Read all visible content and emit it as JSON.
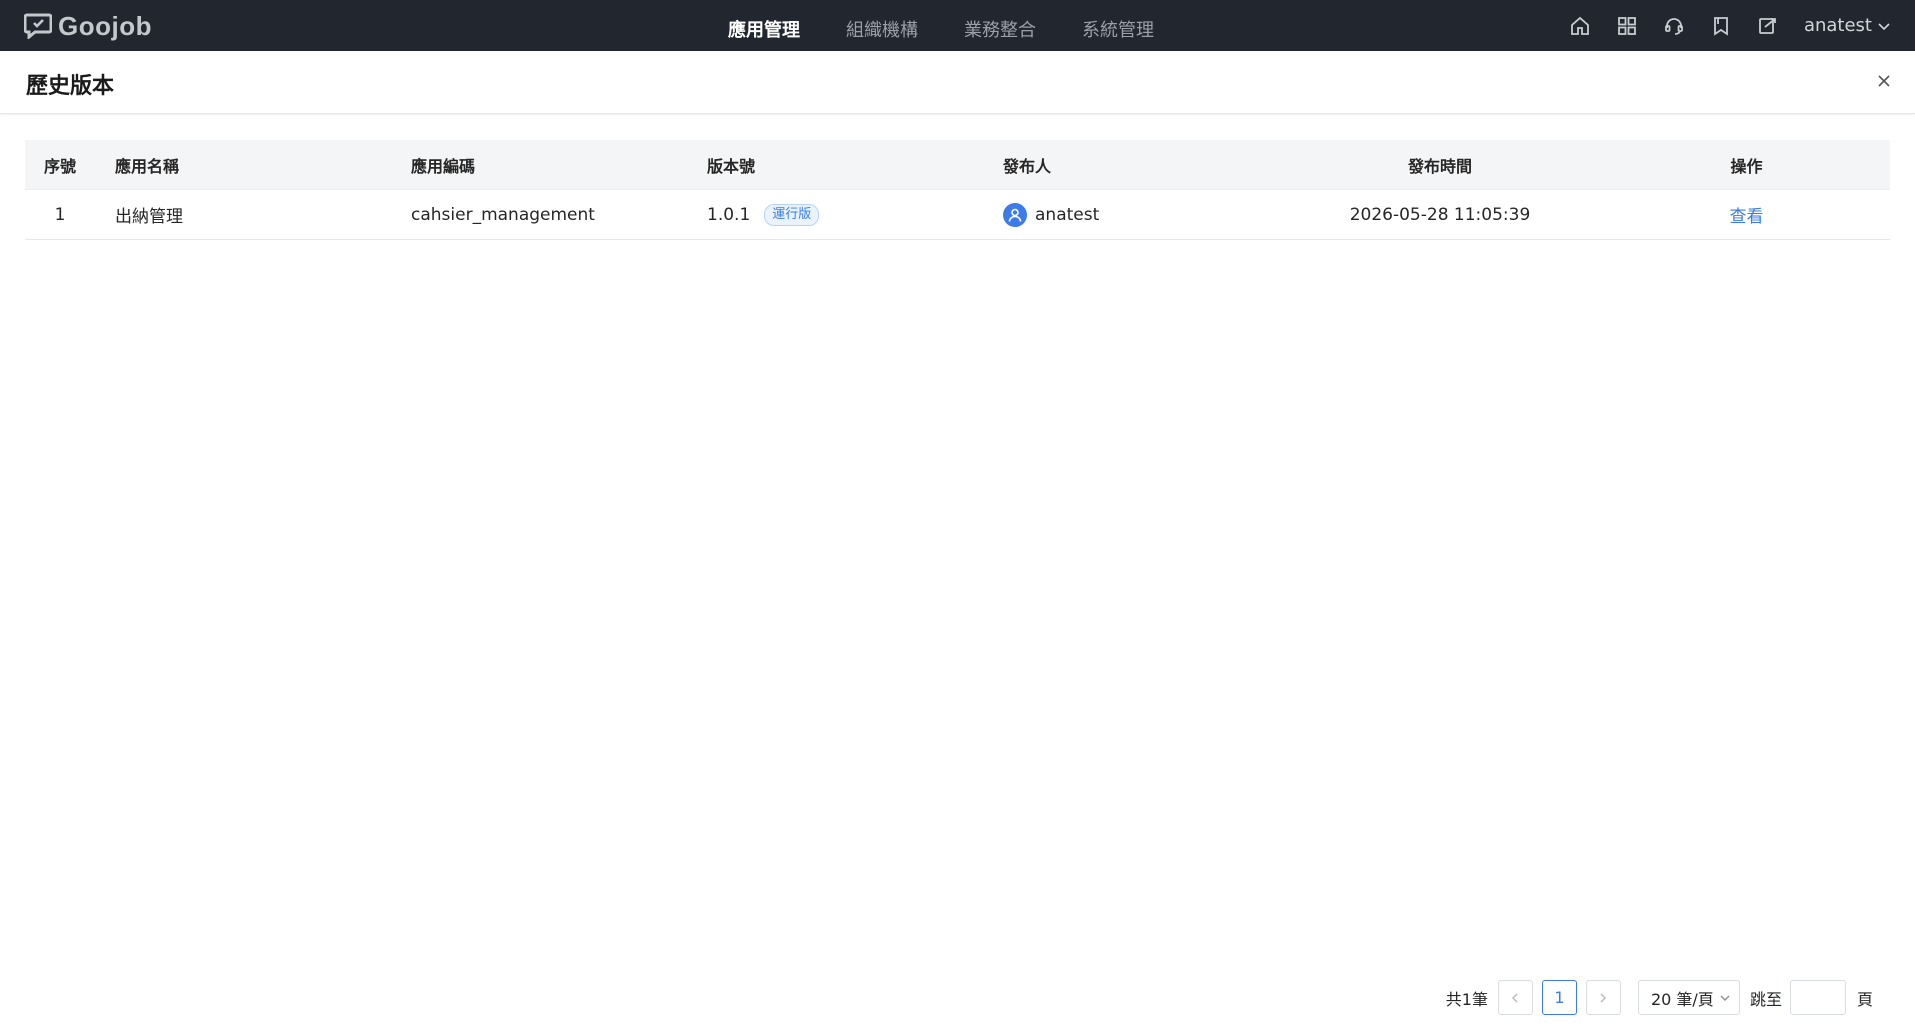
{
  "brand": {
    "name": "Goojob"
  },
  "nav": {
    "items": [
      {
        "label": "應用管理",
        "active": true
      },
      {
        "label": "組織機構",
        "active": false
      },
      {
        "label": "業務整合",
        "active": false
      },
      {
        "label": "系統管理",
        "active": false
      }
    ]
  },
  "toolbar": {
    "icons": [
      "home-icon",
      "apps-grid-icon",
      "support-headset-icon",
      "bookmark-icon",
      "edit-export-icon"
    ],
    "username": "anatest"
  },
  "dialog": {
    "title": "歷史版本"
  },
  "table": {
    "headers": {
      "index": "序號",
      "app_name": "應用名稱",
      "app_code": "應用編碼",
      "version": "版本號",
      "publisher": "發布人",
      "publish_time": "發布時間",
      "action": "操作"
    },
    "rows": [
      {
        "index": "1",
        "app_name": "出納管理",
        "app_code": "cahsier_management",
        "version": "1.0.1",
        "version_tag": "運行版",
        "publisher": "anatest",
        "publish_time": "2026-05-28 11:05:39",
        "action": "查看"
      }
    ]
  },
  "pagination": {
    "total": "共1筆",
    "current_page": "1",
    "page_size": "20 筆/頁",
    "jump_label": "跳至",
    "page_label": "頁",
    "jump_value": ""
  },
  "colors": {
    "topbar_bg": "#22262e",
    "accent": "#3b7be3",
    "header_bg": "#f4f5f7"
  }
}
